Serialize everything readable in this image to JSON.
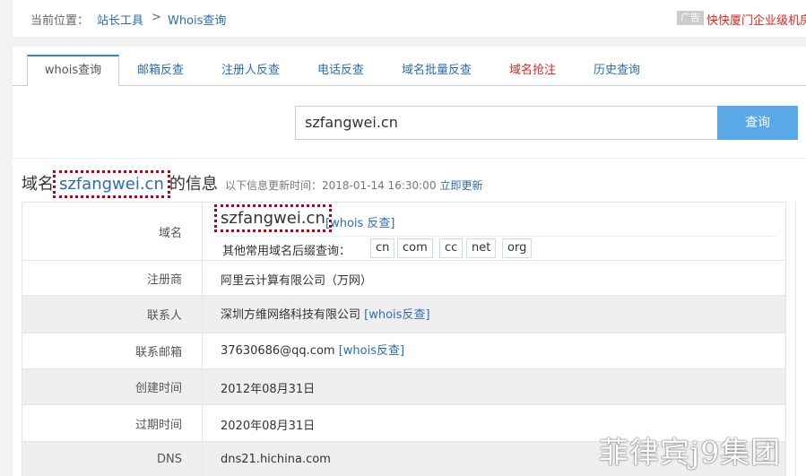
{
  "breadcrumb": {
    "prefix": "当前位置：",
    "items": [
      "站长工具",
      "Whois查询"
    ],
    "separator": ">"
  },
  "ad": {
    "tag": "广告",
    "text": "快快厦门企业级机房"
  },
  "tabs": [
    {
      "label": "whois查询",
      "active": true
    },
    {
      "label": "邮箱反查"
    },
    {
      "label": "注册人反查"
    },
    {
      "label": "电话反查"
    },
    {
      "label": "域名批量反查"
    },
    {
      "label": "域名抢注",
      "color": "#d9281e"
    },
    {
      "label": "历史查询"
    }
  ],
  "search": {
    "value": "szfangwei.cn",
    "button": "查询"
  },
  "info_heading": {
    "prefix": "域名",
    "domain": "szfangwei.cn",
    "suffix": "的信息",
    "meta": "以下信息更新时间：2018-01-14 16:30:00",
    "refresh": "立即更新"
  },
  "rows": {
    "domain": {
      "label": "域名",
      "value": "szfangwei.cn",
      "reverse": "[whois 反查]",
      "suffix_label": "其他常用域名后缀查询：",
      "suffixes": [
        "cn",
        "com",
        "cc",
        "net",
        "org"
      ]
    },
    "registrar": {
      "label": "注册商",
      "value": "阿里云计算有限公司（万网）"
    },
    "contact": {
      "label": "联系人",
      "value": "深圳方维网络科技有限公司",
      "link": "[whois反查]"
    },
    "email": {
      "label": "联系邮箱",
      "value": "37630686@qq.com",
      "link": "[whois反查]"
    },
    "created": {
      "label": "创建时间",
      "value": "2012年08月31日"
    },
    "expires": {
      "label": "过期时间",
      "value": "2020年08月31日"
    },
    "dns": {
      "label": "DNS",
      "value": "dns21.hichina.com"
    }
  },
  "watermark": "菲律宾j9集团",
  "colors": {
    "accent": "#2b6cb0",
    "button": "#5aa9e6",
    "highlight": "#b3001b",
    "red": "#d9281e"
  }
}
